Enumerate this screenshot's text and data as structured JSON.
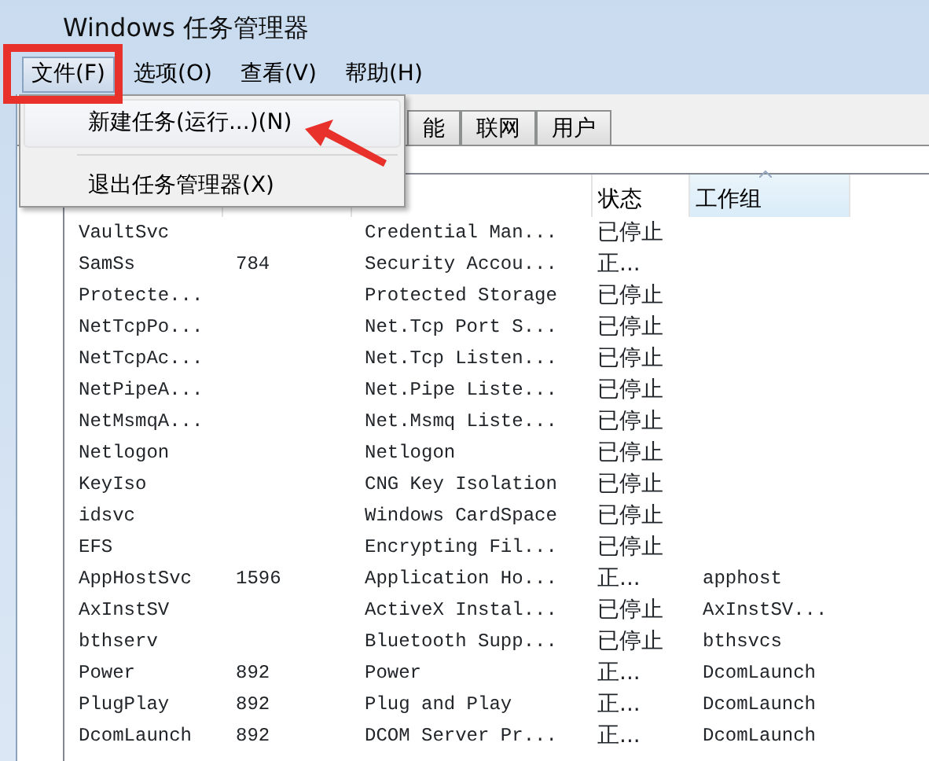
{
  "window": {
    "title": "Windows 任务管理器"
  },
  "menu_bar": [
    {
      "label": "文件(F)",
      "selected": true
    },
    {
      "label": "选项(O)",
      "selected": false
    },
    {
      "label": "查看(V)",
      "selected": false
    },
    {
      "label": "帮助(H)",
      "selected": false
    }
  ],
  "file_menu": [
    {
      "label": "新建任务(运行...)(N)",
      "selected": true
    },
    {
      "label": "退出任务管理器(X)",
      "selected": false
    }
  ],
  "tabs": [
    {
      "label": "能",
      "selected": false
    },
    {
      "label": "联网",
      "selected": false
    },
    {
      "label": "用户",
      "selected": false
    }
  ],
  "table": {
    "columns": [
      {
        "label": "状态",
        "sorted": false
      },
      {
        "label": "工作组",
        "sorted": true
      }
    ],
    "rows": [
      {
        "name": "VaultSvc",
        "description": "Credential Man...",
        "status": "已停止"
      },
      {
        "name": "SamSs",
        "pid": "784",
        "description": "Security Accou...",
        "status": "正..."
      },
      {
        "name": "Protecte...",
        "description": "Protected Storage",
        "status": "已停止"
      },
      {
        "name": "NetTcpPo...",
        "description": "Net.Tcp Port S...",
        "status": "已停止"
      },
      {
        "name": "NetTcpAc...",
        "description": "Net.Tcp Listen...",
        "status": "已停止"
      },
      {
        "name": "NetPipeA...",
        "description": "Net.Pipe Liste...",
        "status": "已停止"
      },
      {
        "name": "NetMsmqA...",
        "description": "Net.Msmq Liste...",
        "status": "已停止"
      },
      {
        "name": "Netlogon",
        "description": "Netlogon",
        "status": "已停止"
      },
      {
        "name": "KeyIso",
        "description": "CNG Key Isolation",
        "status": "已停止"
      },
      {
        "name": "idsvc",
        "description": "Windows CardSpace",
        "status": "已停止"
      },
      {
        "name": "EFS",
        "description": "Encrypting Fil...",
        "status": "已停止"
      },
      {
        "name": "AppHostSvc",
        "pid": "1596",
        "description": "Application Ho...",
        "status": "正...",
        "group": "apphost"
      },
      {
        "name": "AxInstSV",
        "description": "ActiveX Instal...",
        "status": "已停止",
        "group": "AxInstSV..."
      },
      {
        "name": "bthserv",
        "description": "Bluetooth Supp...",
        "status": "已停止",
        "group": "bthsvcs"
      },
      {
        "name": "Power",
        "pid": "892",
        "description": "Power",
        "status": "正...",
        "group": "DcomLaunch"
      },
      {
        "name": "PlugPlay",
        "pid": "892",
        "description": "Plug and Play",
        "status": "正...",
        "group": "DcomLaunch"
      },
      {
        "name": "DcomLaunch",
        "pid": "892",
        "description": "DCOM Server Pr...",
        "status": "正...",
        "group": "DcomLaunch"
      }
    ]
  }
}
